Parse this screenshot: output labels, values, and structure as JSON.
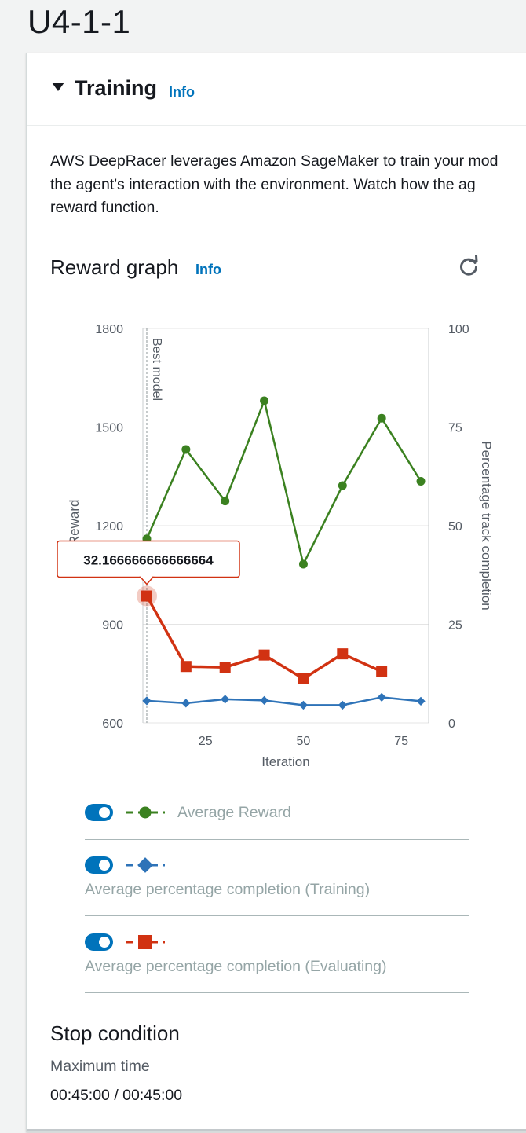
{
  "page": {
    "title": "U4-1-1"
  },
  "training": {
    "header": "Training",
    "info_label": "Info",
    "description_lines": [
      "AWS DeepRacer leverages Amazon SageMaker to train your mod",
      "the agent's interaction with the environment. Watch how the ag",
      "reward function."
    ]
  },
  "reward_graph": {
    "title": "Reward graph",
    "info_label": "Info",
    "refresh_icon": "refresh-icon",
    "tooltip": "32.166666666666664",
    "best_model_label": "Best model",
    "legend": [
      {
        "label": "Average Reward",
        "color": "#3b8120",
        "marker": "circle",
        "enabled": true
      },
      {
        "label": "Average percentage completion (Training)",
        "color": "#2e73b8",
        "marker": "diamond",
        "enabled": true
      },
      {
        "label": "Average percentage completion (Evaluating)",
        "color": "#d13212",
        "marker": "square",
        "enabled": true
      }
    ]
  },
  "chart_data": {
    "type": "line",
    "xlabel": "Iteration",
    "ylabel": "Reward",
    "y2label": "Percentage track completion",
    "xlim": [
      9,
      82
    ],
    "ylim": [
      600,
      1800
    ],
    "y2lim": [
      0,
      100
    ],
    "xticks": [
      25,
      50,
      75
    ],
    "yticks": [
      600,
      900,
      1200,
      1500,
      1800
    ],
    "y2ticks": [
      0,
      25,
      50,
      75,
      100
    ],
    "best_model_x": 10,
    "highlight": {
      "series": "Average percentage completion (Evaluating)",
      "x": 10,
      "y": 32.166666666666664
    },
    "series": [
      {
        "name": "Average Reward",
        "axis": "left",
        "color": "#3b8120",
        "marker": "circle",
        "x": [
          10,
          20,
          30,
          40,
          50,
          60,
          70,
          80
        ],
        "y": [
          1160,
          1432,
          1275,
          1580,
          1083,
          1322,
          1527,
          1335
        ]
      },
      {
        "name": "Average percentage completion (Training)",
        "axis": "right",
        "color": "#2e73b8",
        "marker": "diamond",
        "x": [
          10,
          20,
          30,
          40,
          50,
          60,
          70,
          80
        ],
        "y": [
          5.6,
          5.0,
          6.0,
          5.7,
          4.5,
          4.5,
          6.5,
          5.5
        ]
      },
      {
        "name": "Average percentage completion (Evaluating)",
        "axis": "right",
        "color": "#d13212",
        "marker": "square",
        "x": [
          10,
          20,
          30,
          40,
          50,
          60,
          70
        ],
        "y": [
          32.166666666666664,
          14.3,
          14.1,
          17.2,
          11.2,
          17.5,
          13.0
        ]
      }
    ]
  },
  "stop_condition": {
    "title": "Stop condition",
    "label": "Maximum time",
    "value": "00:45:00 / 00:45:00"
  }
}
